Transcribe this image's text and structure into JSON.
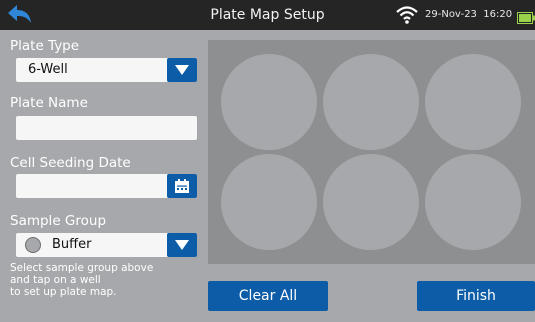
{
  "header": {
    "title": "Plate Map Setup",
    "date": "29-Nov-23",
    "time": "16:20",
    "back_icon": "back-arrow-icon",
    "wifi_icon": "wifi-icon",
    "battery_icon": "battery-icon"
  },
  "plate_type": {
    "label": "Plate Type",
    "value": "6-Well"
  },
  "plate_name": {
    "label": "Plate Name",
    "value": ""
  },
  "seeding_date": {
    "label": "Cell Seeding Date",
    "value": ""
  },
  "sample_group": {
    "label": "Sample Group",
    "value": "Buffer",
    "swatch_color": "#a7a8ab"
  },
  "hint": "Select sample group above\nand tap on a well\nto set up plate map.",
  "buttons": {
    "clear_all": "Clear All",
    "finish": "Finish"
  },
  "wells": [
    "A1",
    "A2",
    "A3",
    "B1",
    "B2",
    "B3"
  ],
  "colors": {
    "accent": "#0c5ca8",
    "background": "#a7a8ab",
    "plate": "#8e8f91",
    "topbar": "#252525"
  }
}
